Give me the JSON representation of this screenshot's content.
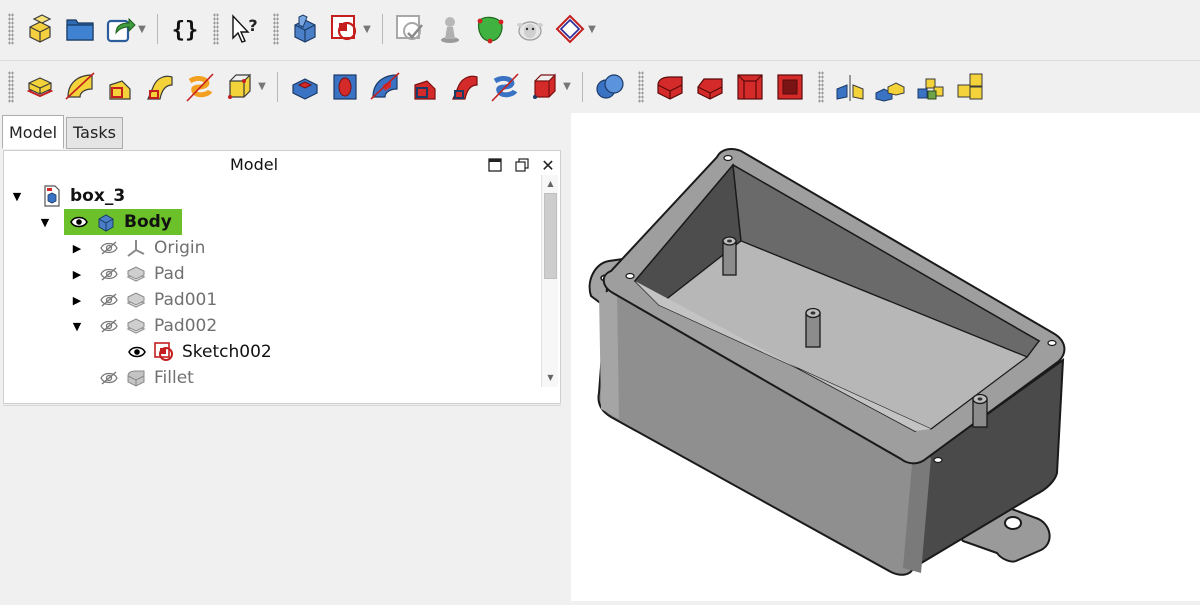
{
  "toolbar_top": [
    {
      "name": "part-design-workbench-icon"
    },
    {
      "name": "open-folder-icon"
    },
    {
      "name": "export-icon",
      "dropdown": true
    },
    {
      "name": "macro-braces-icon"
    },
    {
      "name": "whats-this-icon"
    },
    {
      "name": "create-body-icon"
    },
    {
      "name": "create-sketch-icon",
      "dropdown": true
    },
    {
      "name": "validate-sketch-icon"
    },
    {
      "name": "attach-icon"
    },
    {
      "name": "map-sketch-face-icon"
    },
    {
      "name": "sheep-icon"
    },
    {
      "name": "datum-shape-icon",
      "dropdown": true
    }
  ],
  "toolbar_features": [
    {
      "name": "pad-icon"
    },
    {
      "name": "revolution-icon"
    },
    {
      "name": "additive-loft-icon"
    },
    {
      "name": "additive-pipe-icon"
    },
    {
      "name": "additive-helix-icon"
    },
    {
      "name": "additive-primitive-icon",
      "dropdown": true
    },
    {
      "name": "pocket-icon"
    },
    {
      "name": "hole-icon"
    },
    {
      "name": "groove-icon"
    },
    {
      "name": "subtractive-loft-icon"
    },
    {
      "name": "subtractive-pipe-icon"
    },
    {
      "name": "subtractive-helix-icon"
    },
    {
      "name": "subtractive-primitive-icon",
      "dropdown": true
    },
    {
      "name": "boolean-icon"
    },
    {
      "name": "fillet-icon"
    },
    {
      "name": "chamfer-icon"
    },
    {
      "name": "draft-icon"
    },
    {
      "name": "thickness-icon"
    },
    {
      "name": "mirrored-icon"
    },
    {
      "name": "linear-pattern-icon"
    },
    {
      "name": "polar-pattern-icon"
    },
    {
      "name": "multi-transform-icon"
    }
  ],
  "tabs": [
    "Model",
    "Tasks"
  ],
  "panel": {
    "title": "Model"
  },
  "tree": {
    "document": "box_3",
    "body": "Body",
    "items": [
      {
        "label": "Origin",
        "icon": "origin-icon"
      },
      {
        "label": "Pad",
        "icon": "pad-feature-icon"
      },
      {
        "label": "Pad001",
        "icon": "pad-feature-icon"
      },
      {
        "label": "Pad002",
        "icon": "pad-feature-icon"
      },
      {
        "label": "Sketch002",
        "icon": "sketch-icon"
      },
      {
        "label": "Fillet",
        "icon": "fillet-feature-icon"
      }
    ]
  },
  "colors": {
    "selection": "#6cc12b",
    "model_grey": "#8c8c8c",
    "feature_red": "#d42a2a",
    "feature_yellow": "#f3d23a",
    "feature_blue": "#3a73c4"
  }
}
